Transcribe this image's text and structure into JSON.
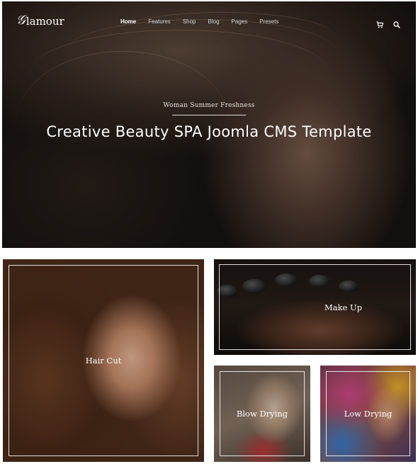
{
  "brand": {
    "logo_mark": "𝒢",
    "logo_text": "lamour"
  },
  "nav": {
    "items": [
      {
        "label": "Home",
        "active": true
      },
      {
        "label": "Features",
        "active": false
      },
      {
        "label": "Shop",
        "active": false
      },
      {
        "label": "Blog",
        "active": false
      },
      {
        "label": "Pages",
        "active": false
      },
      {
        "label": "Presets",
        "active": false
      }
    ],
    "icons": [
      "cart-icon",
      "search-icon"
    ]
  },
  "hero": {
    "subtitle": "Woman Summer Freshness",
    "title": "Creative Beauty SPA Joomla CMS Template"
  },
  "services": [
    {
      "label": "Hair Cut"
    },
    {
      "label": "Make Up"
    },
    {
      "label": "Blow Drying"
    },
    {
      "label": "Low Drying"
    }
  ],
  "colors": {
    "overlay": "#000000",
    "text": "#ffffff",
    "frame": "#ffffff"
  }
}
